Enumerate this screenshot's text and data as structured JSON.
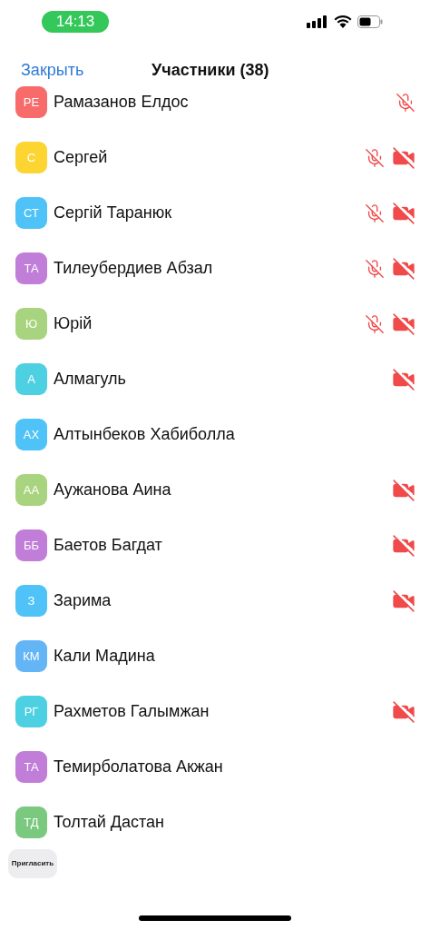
{
  "status_bar": {
    "time": "14:13"
  },
  "header": {
    "close": "Закрыть",
    "title": "Участники (38)"
  },
  "participants": [
    {
      "initials": "РЕ",
      "name": "Рамазанов Елдос",
      "color": "#f86b6b",
      "muted": true,
      "video_off": false
    },
    {
      "initials": "С",
      "name": "Сергей",
      "color": "#fcd532",
      "muted": true,
      "video_off": true
    },
    {
      "initials": "СТ",
      "name": "Сергій Таранюк",
      "color": "#4fc3f7",
      "muted": true,
      "video_off": true
    },
    {
      "initials": "ТА",
      "name": "Тилеубердиев Абзал",
      "color": "#c17ed9",
      "muted": true,
      "video_off": true
    },
    {
      "initials": "Ю",
      "name": "Юрій",
      "color": "#a8d47f",
      "muted": true,
      "video_off": true
    },
    {
      "initials": "А",
      "name": "Алмагуль",
      "color": "#4dd0e1",
      "muted": false,
      "video_off": true
    },
    {
      "initials": "АХ",
      "name": "Алтынбеков Хабиболла",
      "color": "#4fc3f7",
      "muted": false,
      "video_off": false
    },
    {
      "initials": "АА",
      "name": "Аужанова Аина",
      "color": "#a8d47f",
      "muted": false,
      "video_off": true
    },
    {
      "initials": "ББ",
      "name": "Баетов Багдат",
      "color": "#c17ed9",
      "muted": false,
      "video_off": true
    },
    {
      "initials": "З",
      "name": "Зарима",
      "color": "#4fc3f7",
      "muted": false,
      "video_off": true
    },
    {
      "initials": "КМ",
      "name": "Кали Мадина",
      "color": "#64b5f6",
      "muted": false,
      "video_off": false
    },
    {
      "initials": "РГ",
      "name": "Рахметов Галымжан",
      "color": "#4dd0e1",
      "muted": false,
      "video_off": true
    },
    {
      "initials": "ТА",
      "name": "Темирболатова Акжан",
      "color": "#c17ed9",
      "muted": false,
      "video_off": false
    },
    {
      "initials": "ТД",
      "name": "Толтай Дастан",
      "color": "#7bc87f",
      "muted": false,
      "video_off": false
    }
  ],
  "invite_button": "Пригласить"
}
